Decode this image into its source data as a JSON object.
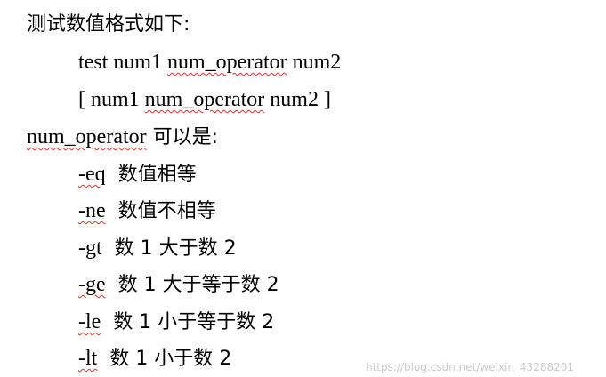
{
  "document": {
    "intro_label": "测试数值格式如下:",
    "syntax1": {
      "prefix": "test num1 ",
      "operator_token": "num_operator",
      "suffix": " num2"
    },
    "syntax2": {
      "prefix": "[ num1 ",
      "operator_token": "num_operator",
      "suffix": " num2 ]"
    },
    "operator_intro": {
      "token": "num_operator",
      "text": " 可以是:"
    },
    "operators": [
      {
        "code": "-eq",
        "desc": "数值相等"
      },
      {
        "code": "-ne",
        "desc": "数值不相等"
      },
      {
        "code": "-gt",
        "desc": "数 1 大于数 2"
      },
      {
        "code": "-ge",
        "desc": "数 1 大于等于数 2"
      },
      {
        "code": "-le",
        "desc": "数 1 小于等于数 2"
      },
      {
        "code": "-lt",
        "desc": "数 1 小于数 2"
      }
    ]
  },
  "watermark": "https://blog.csdn.net/weixin_43288201",
  "colors": {
    "text": "#000000",
    "spellcheck_underline": "#d23a2a",
    "watermark": "#c9c9c9"
  }
}
